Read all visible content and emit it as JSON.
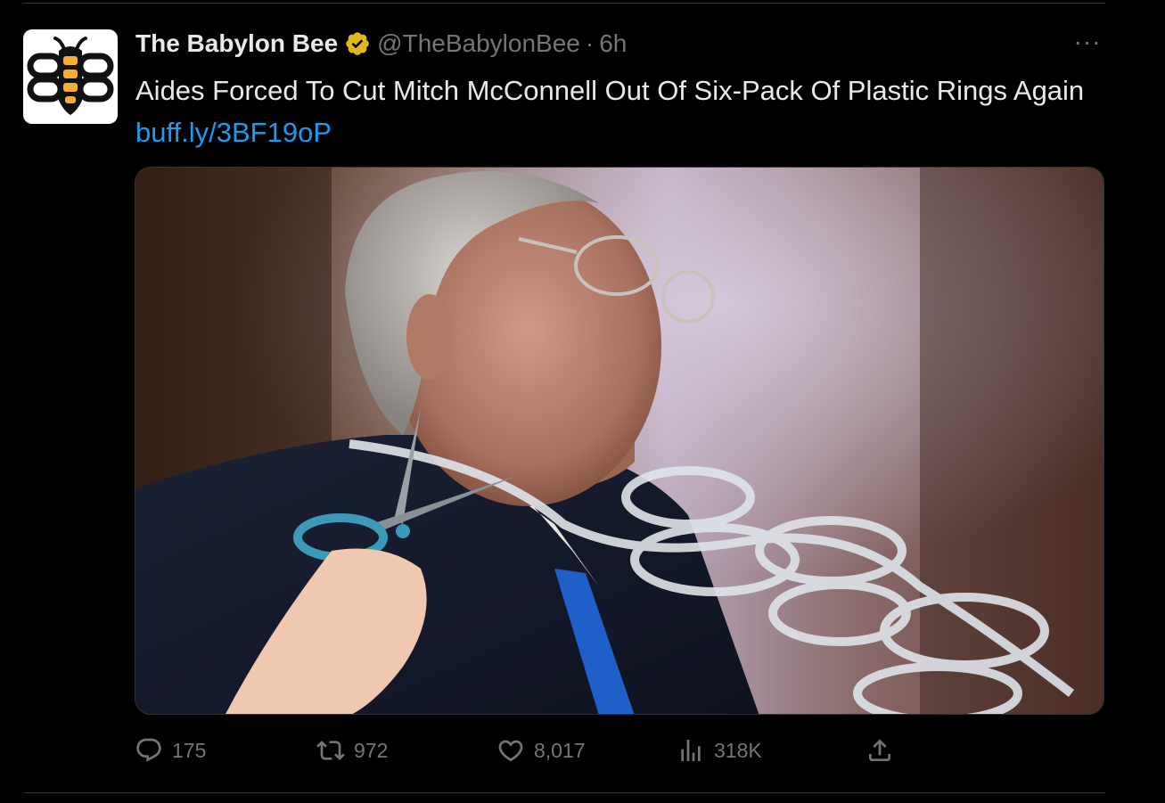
{
  "tweet": {
    "author": {
      "display_name": "The Babylon Bee",
      "handle": "@TheBabylonBee",
      "verified": true,
      "verified_color": "#e2b719",
      "avatar_icon": "bee-logo-icon"
    },
    "separator": "·",
    "time": "6h",
    "more_icon": "more-icon",
    "more_label": "···",
    "text": "Aides Forced To Cut Mitch McConnell Out Of Six-Pack Of Plastic Rings Again ",
    "link": "buff.ly/3BF19oP",
    "link_color": "#1d9bf0",
    "media_icon": "photo-image",
    "actions": {
      "reply": {
        "icon": "reply-icon",
        "count": "175"
      },
      "retweet": {
        "icon": "retweet-icon",
        "count": "972"
      },
      "like": {
        "icon": "heart-icon",
        "count": "8,017"
      },
      "views": {
        "icon": "analytics-icon",
        "count": "318K"
      },
      "share": {
        "icon": "share-icon"
      }
    }
  }
}
